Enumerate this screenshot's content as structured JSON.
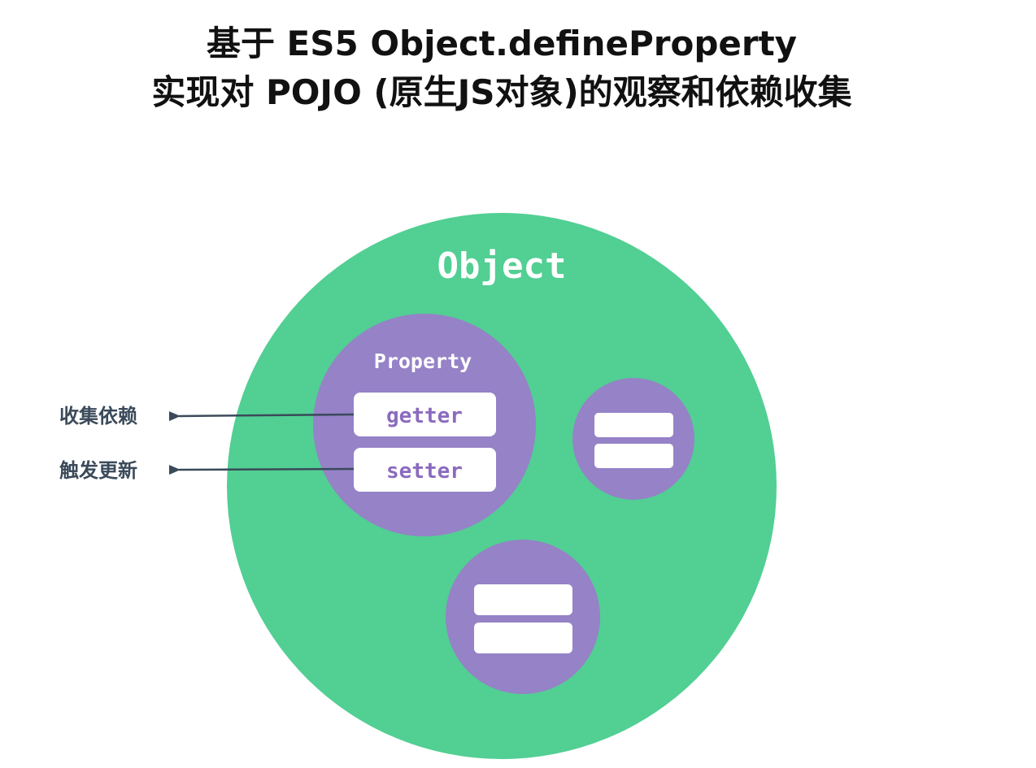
{
  "title": {
    "line1": "基于 ES5 Object.defineProperty",
    "line2": "实现对 POJO (原生JS对象)的观察和依赖收集"
  },
  "diagram": {
    "object_label": "Object",
    "property_label": "Property",
    "getter_label": "getter",
    "setter_label": "setter",
    "collect_label": "收集依赖",
    "trigger_label": "触发更新"
  },
  "colors": {
    "object_fill": "#52cf93",
    "property_fill": "#9582c7",
    "accessor_fill": "#ffffff",
    "accessor_text": "#8b6bbf",
    "arrow": "#3a4a5a"
  }
}
